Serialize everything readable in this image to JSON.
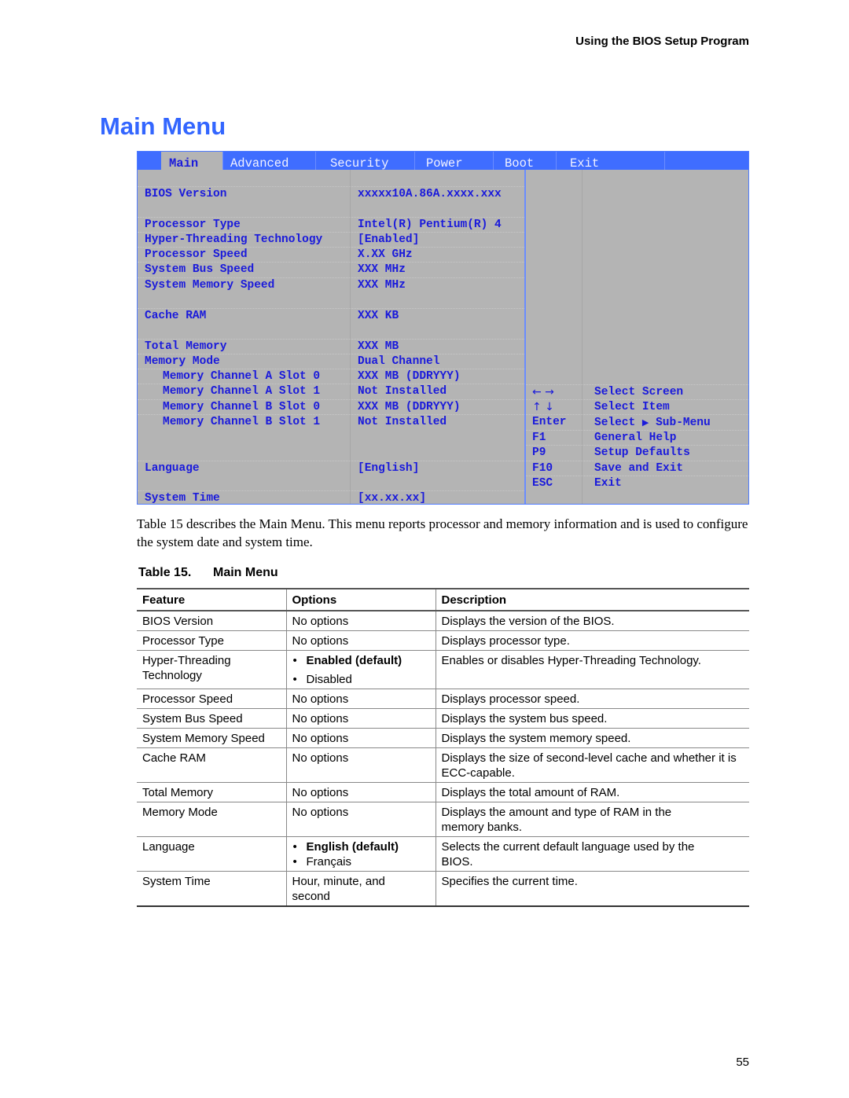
{
  "running_header": "Using the BIOS Setup Program",
  "page_title": "Main Menu",
  "bios": {
    "tabs": [
      {
        "label": "Main",
        "active": true
      },
      {
        "label": "Advanced",
        "active": false
      },
      {
        "label": "Security",
        "active": false
      },
      {
        "label": "Power",
        "active": false
      },
      {
        "label": "Boot",
        "active": false
      },
      {
        "label": "Exit",
        "active": false
      }
    ],
    "items": [
      {
        "label": "BIOS Version",
        "value": "xxxxx10A.86A.xxxx.xxx"
      },
      {
        "label": "Processor Type",
        "value": "Intel(R) Pentium(R) 4"
      },
      {
        "label": "Hyper-Threading Technology",
        "value": "[Enabled]"
      },
      {
        "label": "Processor Speed",
        "value": "X.XX GHz"
      },
      {
        "label": "System Bus Speed",
        "value": "XXX MHz"
      },
      {
        "label": "System Memory Speed",
        "value": "XXX MHz"
      },
      {
        "label": "Cache RAM",
        "value": "XXX KB"
      },
      {
        "label": "Total Memory",
        "value": "XXX MB"
      },
      {
        "label": "Memory Mode",
        "value": "Dual Channel"
      },
      {
        "label": "Memory Channel A Slot 0",
        "value": "XXX MB (DDRYYY)"
      },
      {
        "label": "Memory Channel A Slot 1",
        "value": "Not Installed"
      },
      {
        "label": "Memory Channel B Slot 0",
        "value": "XXX MB (DDRYYY)"
      },
      {
        "label": "Memory Channel B Slot 1",
        "value": "Not Installed"
      },
      {
        "label": "Language",
        "value": "[English]"
      },
      {
        "label": "System Time",
        "value": "[xx.xx.xx]"
      }
    ],
    "help": [
      {
        "key": "← →",
        "desc": "Select Screen",
        "icon": "left-right-arrows-icon"
      },
      {
        "key": "↑ ↓",
        "desc": "Select Item",
        "icon": "up-down-arrows-icon"
      },
      {
        "key": "Enter",
        "desc_pre": "Select",
        "desc_glyph": "▶",
        "desc_post": "Sub-Menu"
      },
      {
        "key": "F1",
        "desc": "General Help"
      },
      {
        "key": "P9",
        "desc": "Setup Defaults"
      },
      {
        "key": "F10",
        "desc": "Save and Exit"
      },
      {
        "key": "ESC",
        "desc": "Exit"
      }
    ],
    "colors": {
      "tab_bar": "#3f6dff",
      "background": "#b4b4b4",
      "text": "#1a1adb"
    }
  },
  "intro_text": "Table 15 describes the Main Menu.  This menu reports processor and memory information and is used to configure the system date and system time.",
  "table": {
    "caption_number": "Table 15.",
    "caption_title": "Main Menu",
    "headers": [
      "Feature",
      "Options",
      "Description"
    ],
    "rows": [
      {
        "feature": "BIOS Version",
        "options": "No options",
        "description": "Displays the version of the BIOS."
      },
      {
        "feature": "Processor Type",
        "options": "No options",
        "description": "Displays processor type."
      },
      {
        "feature": "Hyper-Threading Technology",
        "options_list": [
          {
            "text": "Enabled (default)",
            "default": true
          },
          {
            "text": "Disabled",
            "default": false
          }
        ],
        "description": "Enables or disables Hyper-Threading Technology."
      },
      {
        "feature": "Processor Speed",
        "options": "No options",
        "description": "Displays processor speed."
      },
      {
        "feature": "System Bus Speed",
        "options": "No options",
        "description": "Displays the system bus speed."
      },
      {
        "feature": "System Memory Speed",
        "options": "No options",
        "description": "Displays the system memory speed."
      },
      {
        "feature": "Cache RAM",
        "options": "No options",
        "description": "Displays the size of second-level cache and whether it is ECC-capable."
      },
      {
        "feature": "Total Memory",
        "options": "No options",
        "description": "Displays the total amount of RAM."
      },
      {
        "feature": "Memory Mode",
        "options": "No options",
        "description": "Displays the amount and type of RAM in the memory banks."
      },
      {
        "feature": "Language",
        "options_list": [
          {
            "text": "English (default)",
            "default": true
          },
          {
            "text": "Français",
            "default": false
          }
        ],
        "description": "Selects the current default language used by the BIOS."
      },
      {
        "feature": "System Time",
        "options": "Hour, minute, and second",
        "description": "Specifies the current time."
      }
    ]
  },
  "page_number": "55"
}
